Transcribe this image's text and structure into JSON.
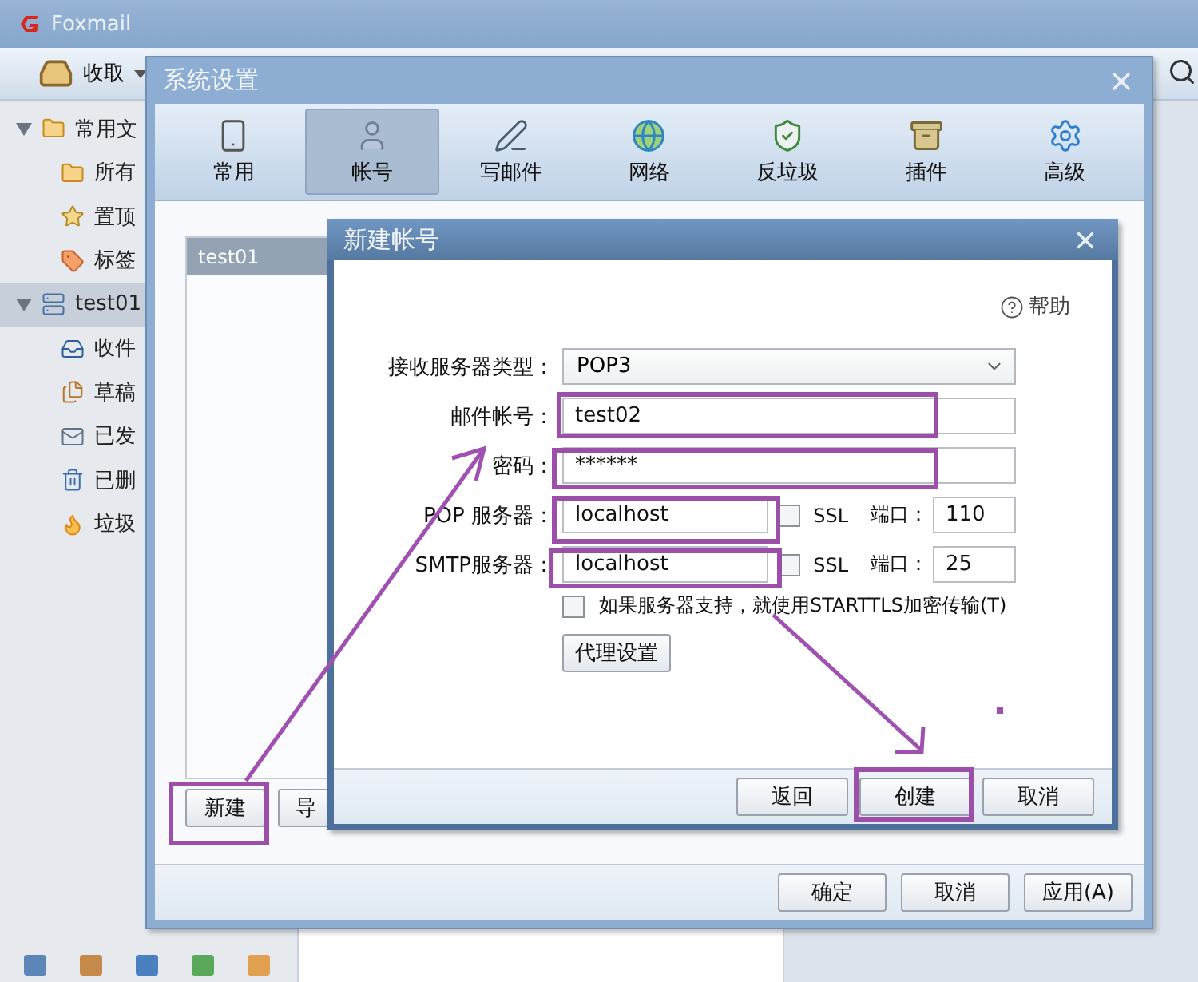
{
  "app": {
    "title": "Foxmail",
    "receive_button": "收取"
  },
  "sidebar": {
    "groups": [
      {
        "label": "常用文",
        "kind": "folder",
        "expanded": true,
        "selected": false,
        "children": [
          {
            "label": "所有",
            "kind": "folder"
          },
          {
            "label": "置顶",
            "kind": "star"
          },
          {
            "label": "标签",
            "kind": "tag"
          }
        ]
      },
      {
        "label": "test01",
        "kind": "account",
        "expanded": true,
        "selected": true,
        "children": [
          {
            "label": "收件",
            "kind": "inbox"
          },
          {
            "label": "草稿",
            "kind": "drafts"
          },
          {
            "label": "已发",
            "kind": "sent"
          },
          {
            "label": "已删",
            "kind": "trash"
          },
          {
            "label": "垃圾",
            "kind": "junk"
          }
        ]
      }
    ]
  },
  "settings_dialog": {
    "title": "系统设置",
    "tabs": [
      {
        "label": "常用",
        "kind": "general",
        "selected": false
      },
      {
        "label": "帐号",
        "kind": "account",
        "selected": true
      },
      {
        "label": "写邮件",
        "kind": "compose",
        "selected": false
      },
      {
        "label": "网络",
        "kind": "network",
        "selected": false
      },
      {
        "label": "反垃圾",
        "kind": "antispam",
        "selected": false
      },
      {
        "label": "插件",
        "kind": "plugin",
        "selected": false
      },
      {
        "label": "高级",
        "kind": "advanced",
        "selected": false
      }
    ],
    "accounts": [
      {
        "name": "test01",
        "selected": true
      }
    ],
    "list_buttons": [
      "新建",
      "导"
    ],
    "footer_buttons": [
      "确定",
      "取消",
      "应用(A)"
    ]
  },
  "new_account_dialog": {
    "title": "新建帐号",
    "help": "帮助",
    "fields": [
      {
        "kind": "select",
        "label": "接收服务器类型：",
        "value": "POP3"
      },
      {
        "kind": "text",
        "label": "邮件帐号：",
        "value": "test02"
      },
      {
        "kind": "text",
        "label": "密码：",
        "value": "******"
      },
      {
        "kind": "server",
        "label": "POP 服务器：",
        "value": "localhost",
        "ssl_label": "SSL",
        "ssl_checked": false,
        "port_label": "端口：",
        "port": "110"
      },
      {
        "kind": "server",
        "label": "SMTP服务器：",
        "value": "localhost",
        "ssl_label": "SSL",
        "ssl_checked": false,
        "port_label": "端口：",
        "port": "25"
      }
    ],
    "starttls": {
      "label": "如果服务器支持，就使用STARTTLS加密传输(T)",
      "checked": false
    },
    "proxy_button": "代理设置",
    "buttons": [
      "返回",
      "创建",
      "取消"
    ]
  }
}
